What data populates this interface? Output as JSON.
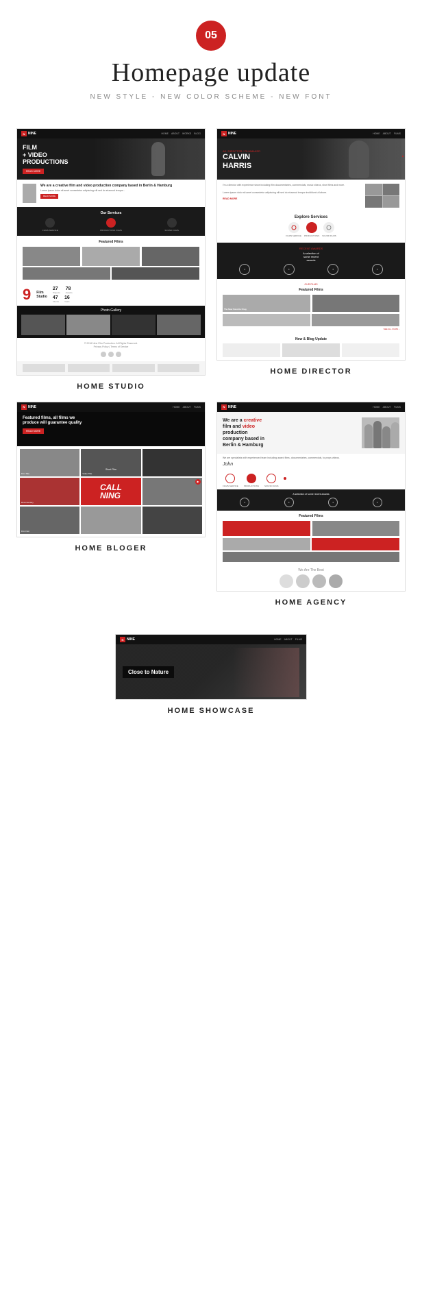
{
  "header": {
    "badge": "05",
    "title": "Homepage update",
    "subtitle": "NEW STYLE - NEW COLOR SCHEME - NEW FONT"
  },
  "screenshots": [
    {
      "id": "home-studio",
      "label": "HOME STUDIO",
      "hero_title": "FILM\n+ VIDEO\nPRODUCTIONS",
      "nav_logo": "NINE",
      "section1_title": "Our Services",
      "section2_title": "Featured Films",
      "stat_big": "9",
      "stat_text": "Film\nStudio",
      "gallery_label": "Photo Gallery"
    },
    {
      "id": "home-director",
      "label": "HOME DIRECTOR",
      "hero_name": "CALVIN\nHARRIS",
      "hero_sub": "AK. DIRECTOR / FILMMAKER",
      "services_label": "Explore Services",
      "awards_text": "A selection of\nsome recent\nawards",
      "films_label": "Featured Films",
      "blog_label": "New & Blog Update"
    },
    {
      "id": "home-blogger",
      "label": "HOME BLOGER",
      "hero_text": "Featured films, all films we\nproduce will guarantee quality",
      "nav_logo": "NINE"
    },
    {
      "id": "home-showcase",
      "label": "HOME SHOWCASE",
      "hero_title": "Close to Nature",
      "nav_logo": "NINE"
    },
    {
      "id": "home-agency",
      "label": "HOME AGENCY",
      "hero_title": "We are a creative\nfilm and video\nproduction\ncompany based in\nBerlin & Hamburg",
      "nav_logo": "NINE",
      "team_label": "We Are The Best",
      "films_label": "Featured Films"
    }
  ],
  "colors": {
    "accent": "#cc2222",
    "dark": "#1a1a1a",
    "navbar": "#111111",
    "text": "#222222",
    "muted": "#888888",
    "white": "#ffffff"
  }
}
